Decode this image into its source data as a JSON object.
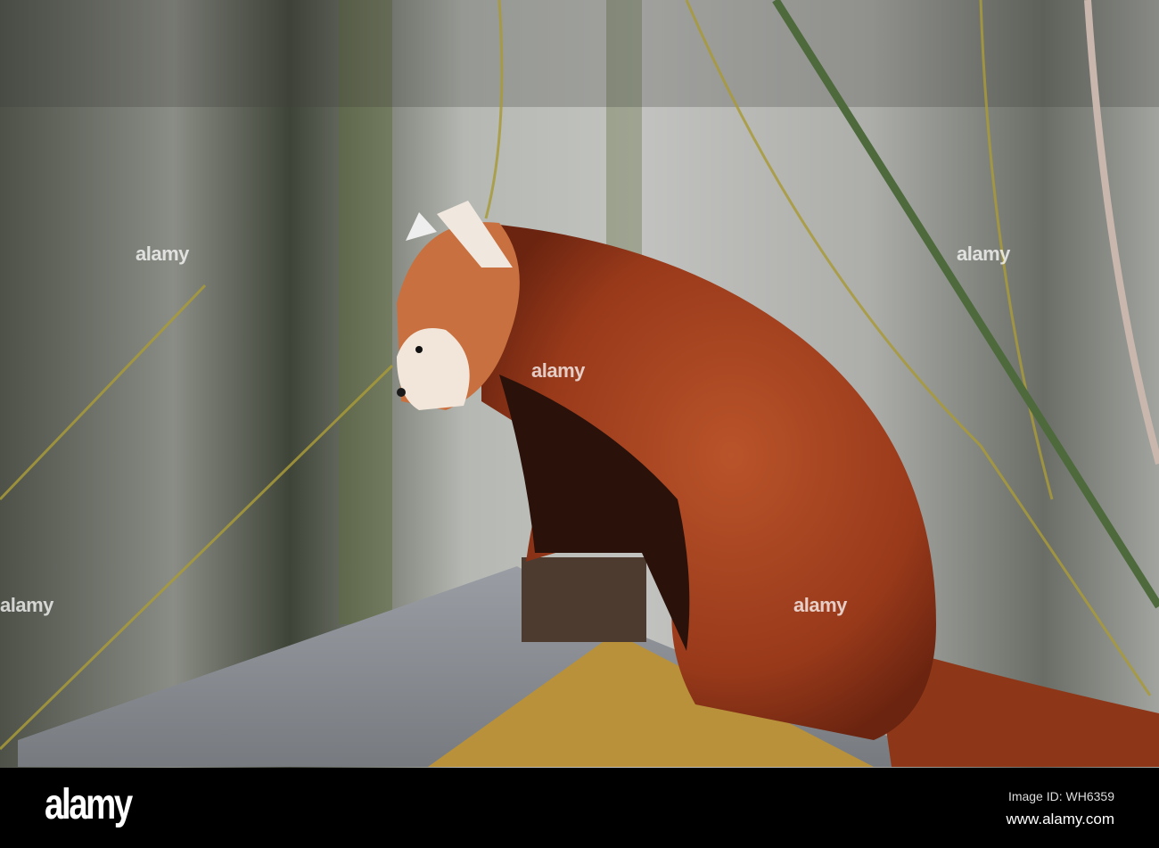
{
  "watermark": {
    "text": "alamy"
  },
  "footer": {
    "logo": "alamy",
    "image_id": "Image ID: WH6359",
    "website": "www.alamy.com"
  },
  "colors": {
    "fur": "#a8451f",
    "wall": "#9ea09a",
    "roof": "#8a8d92",
    "bar": "#000000"
  }
}
